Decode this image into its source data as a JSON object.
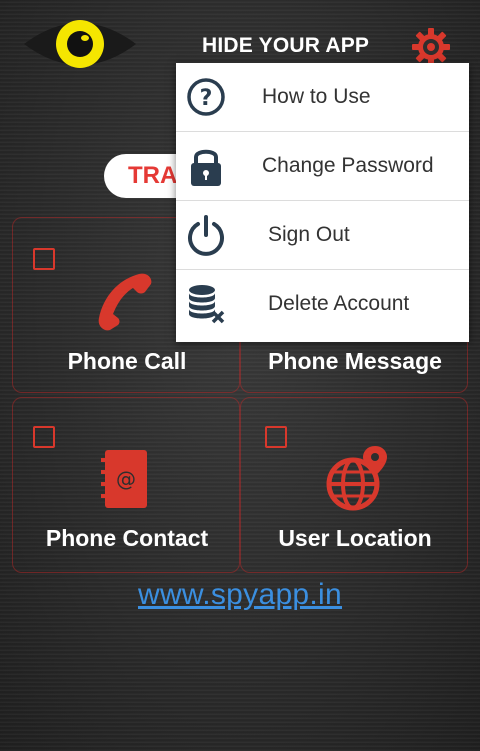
{
  "header": {
    "title": "HIDE YOUR APP",
    "logo_icon": "eye-logo-icon",
    "settings_icon": "gear-icon"
  },
  "track_button": {
    "label": "TRA"
  },
  "tiles": [
    {
      "label": "Phone Call",
      "icon": "phone-handset-icon"
    },
    {
      "label": "Phone Message",
      "icon": "message-icon"
    },
    {
      "label": "Phone Contact",
      "icon": "address-book-icon"
    },
    {
      "label": "User Location",
      "icon": "globe-pin-icon"
    }
  ],
  "footer": {
    "link_text": "www.spyapp.in"
  },
  "menu": {
    "items": [
      {
        "label": "How to Use",
        "icon": "help-icon"
      },
      {
        "label": "Change Password",
        "icon": "lock-icon"
      },
      {
        "label": "Sign Out",
        "icon": "power-icon"
      },
      {
        "label": "Delete Account",
        "icon": "delete-database-icon"
      }
    ]
  },
  "colors": {
    "accent_red": "#d8382c",
    "eye_yellow": "#f5e600",
    "link_blue": "#3b8fe0",
    "menu_text": "#333333"
  }
}
